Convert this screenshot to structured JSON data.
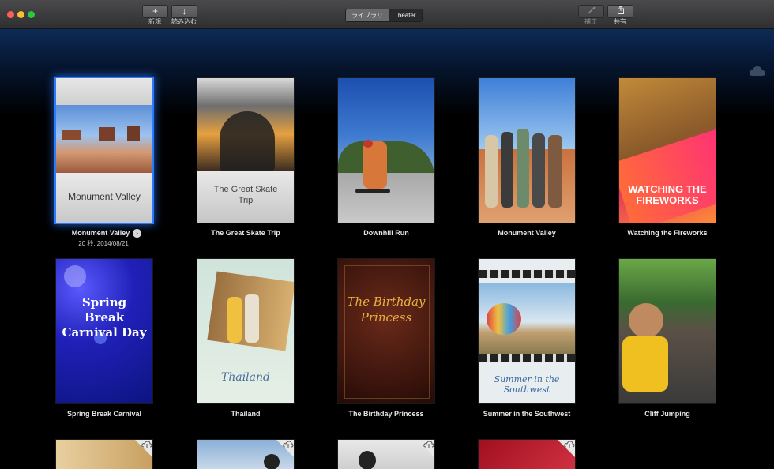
{
  "toolbar": {
    "new_label": "新規",
    "new_icon": "plus-icon",
    "import_label": "読み込む",
    "import_icon": "arrow-down-icon",
    "segment_library": "ライブラリ",
    "segment_theater": "Theater",
    "enhance_label": "補正",
    "enhance_icon": "magic-wand-icon",
    "share_label": "共有",
    "share_icon": "share-icon"
  },
  "cards": [
    {
      "title": "Monument Valley",
      "poster_text": "Monument Valley",
      "detail": "20 秒, 2014/08/21",
      "selected": true
    },
    {
      "title": "The Great Skate Trip",
      "poster_text": "The Great Skate Trip"
    },
    {
      "title": "Downhill Run"
    },
    {
      "title": "Monument Valley"
    },
    {
      "title": "Watching the Fireworks",
      "poster_text": "WATCHING THE FIREWORKS"
    },
    {
      "title": "Spring Break Carnival",
      "poster_text": "Spring Break Carnival Day"
    },
    {
      "title": "Thailand",
      "poster_text": "Thailand"
    },
    {
      "title": "The Birthday Princess",
      "poster_text": "The Birthday Princess"
    },
    {
      "title": "Summer in the Southwest",
      "poster_text": "Summer in the Southwest"
    },
    {
      "title": "Cliff Jumping"
    }
  ],
  "colors": {
    "accent_selection": "#2a7bff",
    "background_top": "#0d2b56"
  }
}
